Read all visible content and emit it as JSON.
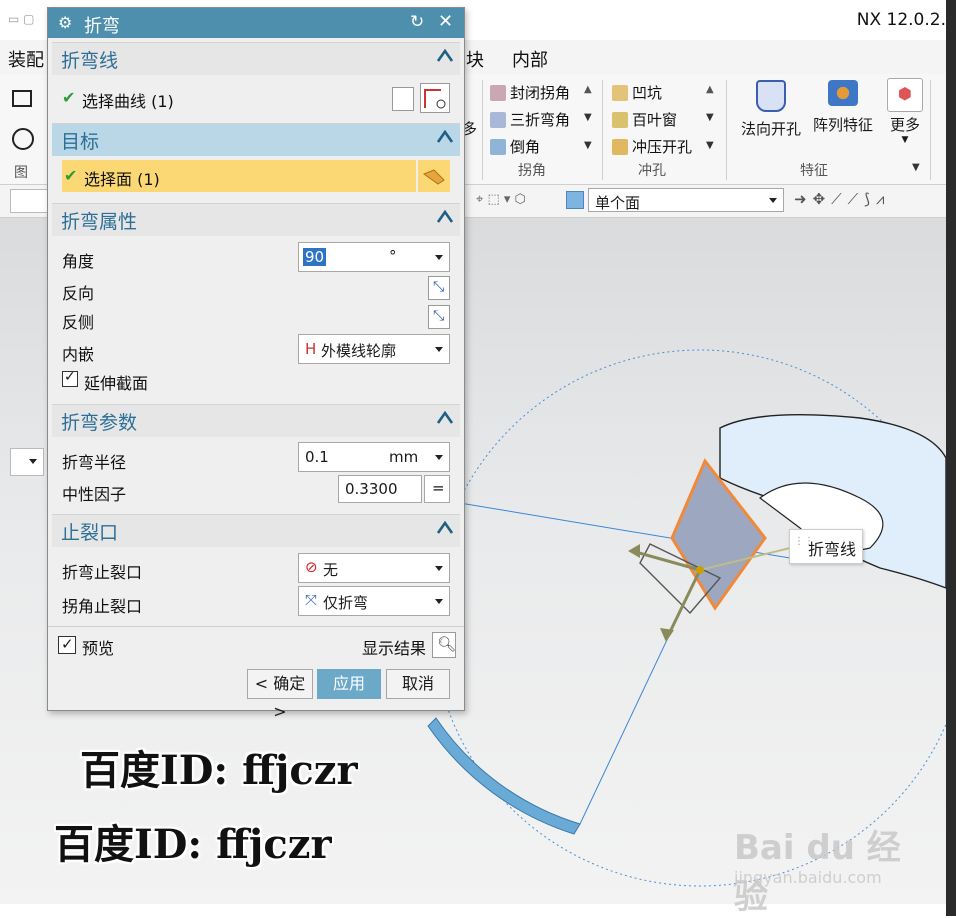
{
  "app": {
    "title": "NX 12.0.2."
  },
  "menubar": {
    "items": [
      "装配",
      "块",
      "内部"
    ]
  },
  "ribbon": {
    "corner_items": [
      "封闭拐角",
      "三折弯角",
      "倒角"
    ],
    "corner_group": "拐角",
    "punch_items": [
      "凹坑",
      "百叶窗",
      "冲压开孔"
    ],
    "punch_group": "冲孔",
    "feature_items": [
      "法向开孔",
      "阵列特征",
      "更多"
    ],
    "feature_group": "特征",
    "left_partial": "图",
    "more_partial": "多"
  },
  "selection_bar": {
    "filter_value": "单个面"
  },
  "dialog": {
    "title": "折弯",
    "sections": {
      "bend_line": {
        "header": "折弯线",
        "select_curve": "选择曲线 (1)"
      },
      "target": {
        "header": "目标",
        "select_face": "选择面 (1)"
      },
      "bend_props": {
        "header": "折弯属性",
        "angle_label": "角度",
        "angle_value": "90",
        "angle_unit": "°",
        "reverse_label": "反向",
        "flip_side_label": "反侧",
        "inset_label": "内嵌",
        "inset_value": "外模线轮廓",
        "inset_icon": "H",
        "extend_label": "延伸截面",
        "extend_checked": true
      },
      "bend_params": {
        "header": "折弯参数",
        "radius_label": "折弯半径",
        "radius_value": "0.1",
        "radius_unit": "mm",
        "k_label": "中性因子",
        "k_value": "0.3300",
        "k_eq": "="
      },
      "relief": {
        "header": "止裂口",
        "bend_relief_label": "折弯止裂口",
        "bend_relief_value": "无",
        "corner_relief_label": "拐角止裂口",
        "corner_relief_value": "仅折弯"
      }
    },
    "preview_label": "预览",
    "preview_checked": true,
    "show_result_label": "显示结果",
    "ok_label": "< 确定 >",
    "apply_label": "应用",
    "cancel_label": "取消"
  },
  "viewport": {
    "bend_line_tag": "折弯线"
  },
  "watermarks": [
    "百度ID: ffjczr",
    "百度ID: ffjczr"
  ],
  "baidu": {
    "logo_text": "Bai du 经验",
    "url": "jingyan.baidu.com"
  },
  "colors": {
    "dialog_title": "#4d8fac",
    "header_text": "#2d6f97",
    "target_row": "#fbd873",
    "apply": "#6ca9c9"
  }
}
